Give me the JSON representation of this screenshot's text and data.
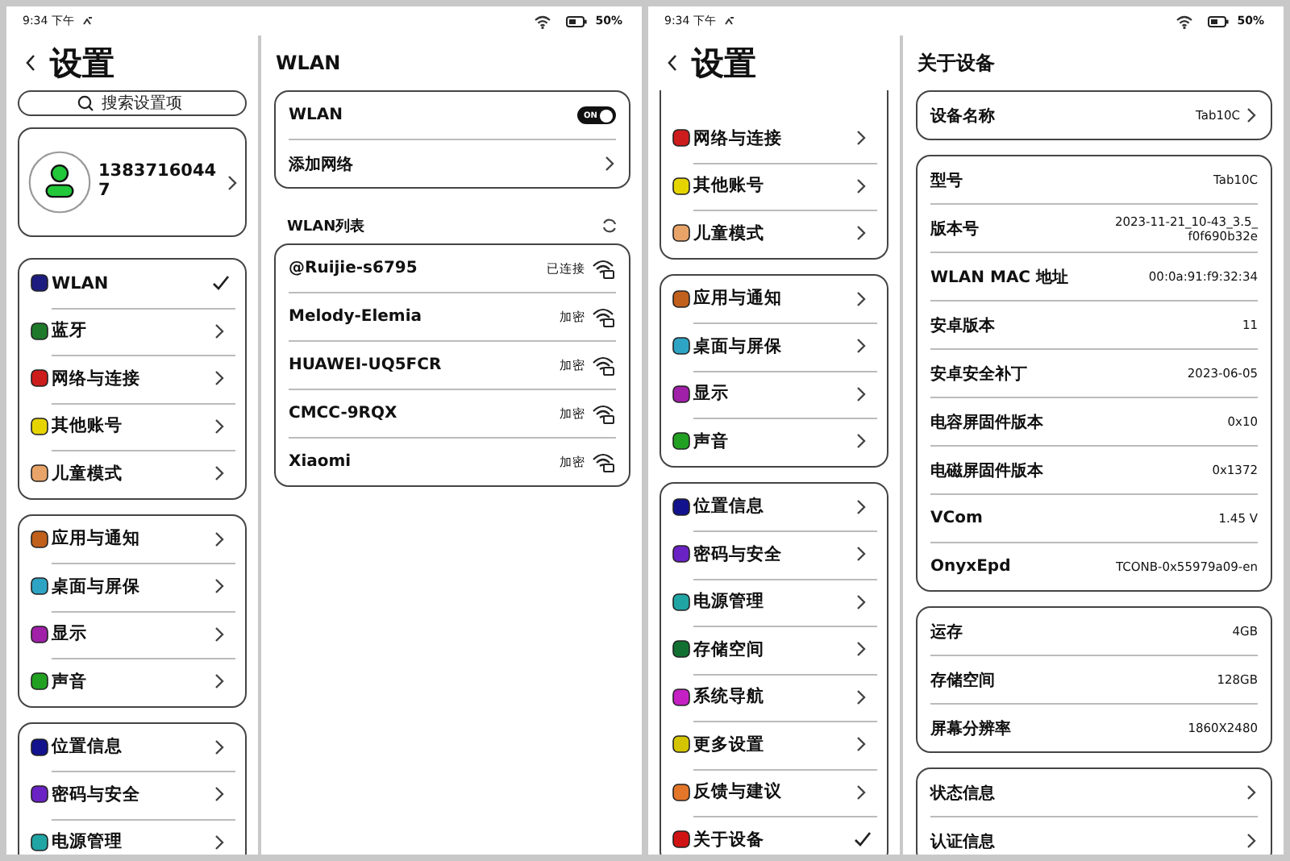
{
  "screens": [
    {
      "status_bar": {
        "time": "9:34 下午",
        "battery": "50%"
      },
      "sidebar": {
        "title": "设置",
        "scrolled": false,
        "search": {
          "placeholder": "搜索设置项"
        },
        "profile": {
          "name": "13837160447"
        },
        "groups": [
          [
            {
              "label": "WLAN",
              "color": "#1c1c80",
              "selected": true
            },
            {
              "label": "蓝牙",
              "color": "#1e7a2a",
              "selected": false
            },
            {
              "label": "网络与连接",
              "color": "#cc1c1c",
              "selected": false
            },
            {
              "label": "其他账号",
              "color": "#e6d400",
              "selected": false
            },
            {
              "label": "儿童模式",
              "color": "#e8a468",
              "selected": false
            }
          ],
          [
            {
              "label": "应用与通知",
              "color": "#c0601c",
              "selected": false
            },
            {
              "label": "桌面与屏保",
              "color": "#2ea4c4",
              "selected": false
            },
            {
              "label": "显示",
              "color": "#a020a8",
              "selected": false
            },
            {
              "label": "声音",
              "color": "#22a022",
              "selected": false
            }
          ],
          [
            {
              "label": "位置信息",
              "color": "#12128e",
              "selected": false
            },
            {
              "label": "密码与安全",
              "color": "#6a22c4",
              "selected": false
            },
            {
              "label": "电源管理",
              "color": "#20a4a4",
              "selected": false
            }
          ]
        ]
      },
      "detail": {
        "title": "WLAN",
        "cards": [
          {
            "rows": [
              {
                "kind": "toggle",
                "label": "WLAN",
                "on": true,
                "toggle_text": "ON"
              },
              {
                "kind": "link",
                "label": "添加网络"
              }
            ]
          },
          {
            "heading": "WLAN列表",
            "rows": [
              {
                "kind": "network",
                "label": "@Ruijie-s6795",
                "value": "已连接"
              },
              {
                "kind": "network",
                "label": "Melody-Elemia",
                "value": "加密"
              },
              {
                "kind": "network",
                "label": "HUAWEI-UQ5FCR",
                "value": "加密"
              },
              {
                "kind": "network",
                "label": "CMCC-9RQX",
                "value": "加密"
              },
              {
                "kind": "network",
                "label": "Xiaomi",
                "value": "加密"
              }
            ]
          }
        ]
      }
    },
    {
      "status_bar": {
        "time": "9:34 下午",
        "battery": "50%"
      },
      "sidebar": {
        "title": "设置",
        "scrolled": true,
        "groups": [
          [
            {
              "label": "网络与连接",
              "color": "#cc1c1c",
              "selected": false
            },
            {
              "label": "其他账号",
              "color": "#e6d400",
              "selected": false
            },
            {
              "label": "儿童模式",
              "color": "#e8a468",
              "selected": false
            }
          ],
          [
            {
              "label": "应用与通知",
              "color": "#c0601c",
              "selected": false
            },
            {
              "label": "桌面与屏保",
              "color": "#2ea4c4",
              "selected": false
            },
            {
              "label": "显示",
              "color": "#a020a8",
              "selected": false
            },
            {
              "label": "声音",
              "color": "#22a022",
              "selected": false
            }
          ],
          [
            {
              "label": "位置信息",
              "color": "#12128e",
              "selected": false
            },
            {
              "label": "密码与安全",
              "color": "#6a22c4",
              "selected": false
            },
            {
              "label": "电源管理",
              "color": "#20a4a4",
              "selected": false
            },
            {
              "label": "存储空间",
              "color": "#127032",
              "selected": false
            },
            {
              "label": "系统导航",
              "color": "#c420c4",
              "selected": false
            },
            {
              "label": "更多设置",
              "color": "#d4c400",
              "selected": false
            },
            {
              "label": "反馈与建议",
              "color": "#e4762a",
              "selected": false
            },
            {
              "label": "关于设备",
              "color": "#d01414",
              "selected": true
            }
          ]
        ]
      },
      "detail": {
        "title": "关于设备",
        "cards": [
          {
            "rows": [
              {
                "kind": "link",
                "label": "设备名称",
                "value": "Tab10C"
              }
            ]
          },
          {
            "rows": [
              {
                "kind": "info",
                "label": "型号",
                "value": "Tab10C"
              },
              {
                "kind": "info",
                "label": "版本号",
                "value": "2023-11-21_10-43_3.5_f0f690b32e"
              },
              {
                "kind": "info",
                "label": "WLAN MAC 地址",
                "value": "00:0a:91:f9:32:34"
              },
              {
                "kind": "info",
                "label": "安卓版本",
                "value": "11"
              },
              {
                "kind": "info",
                "label": "安卓安全补丁",
                "value": "2023-06-05"
              },
              {
                "kind": "info",
                "label": "电容屏固件版本",
                "value": "0x10"
              },
              {
                "kind": "info",
                "label": "电磁屏固件版本",
                "value": "0x1372"
              },
              {
                "kind": "info",
                "label": "VCom",
                "value": "1.45 V"
              },
              {
                "kind": "info",
                "label": "OnyxEpd",
                "value": "TCONB-0x55979a09-en"
              }
            ]
          },
          {
            "rows": [
              {
                "kind": "info",
                "label": "运存",
                "value": "4GB"
              },
              {
                "kind": "info",
                "label": "存储空间",
                "value": "128GB"
              },
              {
                "kind": "info",
                "label": "屏幕分辨率",
                "value": "1860X2480"
              }
            ]
          },
          {
            "rows": [
              {
                "kind": "link",
                "label": "状态信息"
              },
              {
                "kind": "link",
                "label": "认证信息"
              }
            ]
          }
        ]
      }
    }
  ]
}
